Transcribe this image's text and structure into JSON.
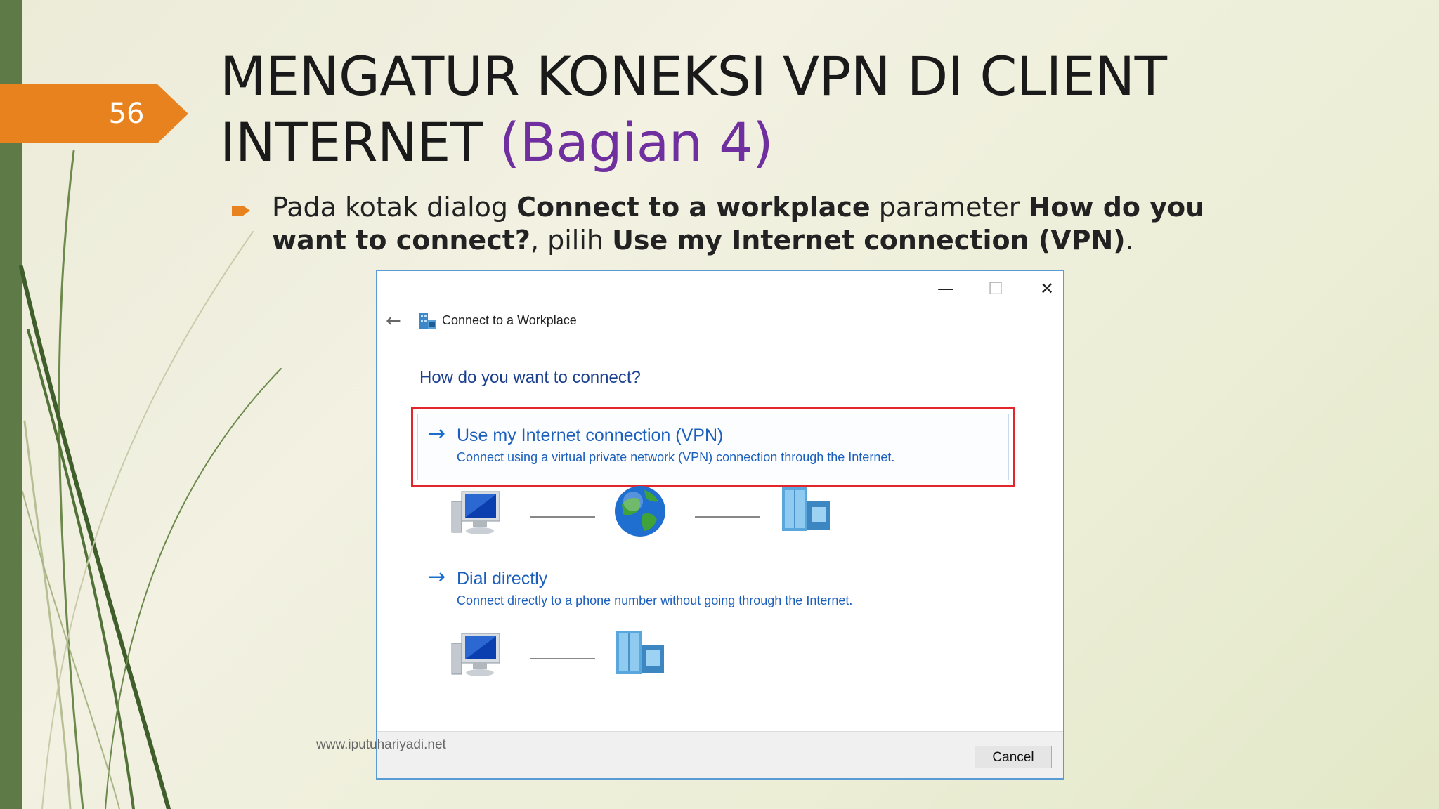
{
  "slide": {
    "page_number": "56",
    "title_line1": "MENGATUR KONEKSI VPN DI CLIENT",
    "title_line2": "INTERNET",
    "title_accent": "(Bagian 4)",
    "bullet": {
      "t1": "Pada kotak dialog ",
      "b1": "Connect to a workplace",
      "t2": " parameter ",
      "b2": "How do you want to connect?",
      "t3": ", pilih ",
      "b3": "Use my Internet connection (VPN)",
      "t4": "."
    },
    "watermark": "www.iputuhariyadi.net",
    "colors": {
      "accent_purple": "#6f2f9f",
      "tag_orange": "#e8821e",
      "sidebar_green": "#5e7a46"
    }
  },
  "dialog": {
    "title": "Connect to a Workplace",
    "minimize_icon": "—",
    "maximize_icon": "☐",
    "close_icon": "✕",
    "back_icon": "←",
    "question": "How do you want to connect?",
    "options": [
      {
        "arrow": "→",
        "title": "Use my Internet connection (VPN)",
        "description": "Connect using a virtual private network (VPN) connection through the Internet."
      },
      {
        "arrow": "→",
        "title": "Dial directly",
        "description": "Connect directly to a phone number without going through the Internet."
      }
    ],
    "cancel_label": "Cancel",
    "highlight_color": "#e3262b",
    "link_color": "#1b5fbd"
  }
}
